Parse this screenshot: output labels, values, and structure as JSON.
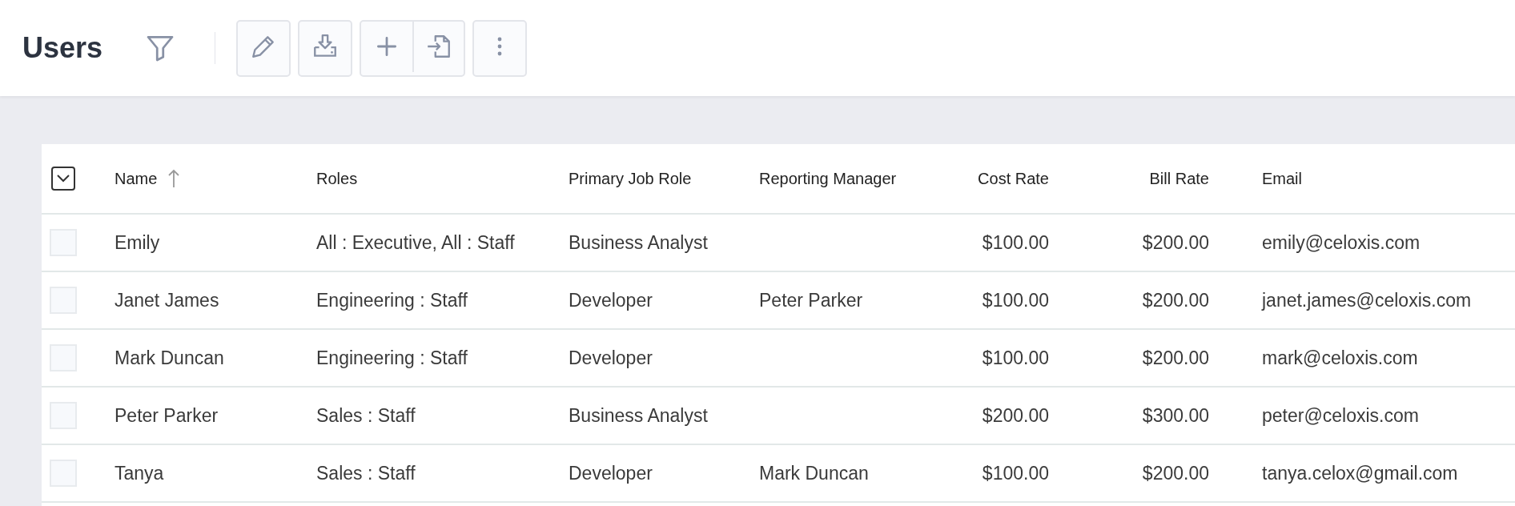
{
  "header": {
    "title": "Users",
    "toolbar": [
      {
        "kind": "filter"
      },
      {
        "kind": "divider"
      },
      {
        "kind": "edit"
      },
      {
        "kind": "download"
      },
      {
        "kind": "add"
      },
      {
        "kind": "import"
      },
      {
        "kind": "more"
      }
    ]
  },
  "table": {
    "columns": [
      {
        "label": "Name",
        "sorted": true
      },
      {
        "label": "Roles",
        "sorted": false
      },
      {
        "label": "Primary Job Role",
        "sorted": false
      },
      {
        "label": "Reporting Manager",
        "sorted": false
      },
      {
        "label": "Cost Rate",
        "sorted": false
      },
      {
        "label": "Bill Rate",
        "sorted": false
      },
      {
        "label": "Email",
        "sorted": false
      }
    ],
    "rows": [
      {
        "selected": false,
        "cells": [
          "Emily",
          "All : Executive, All : Staff",
          "Business Analyst",
          "",
          "$100.00",
          "$200.00",
          "emily@celoxis.com"
        ]
      },
      {
        "selected": false,
        "cells": [
          "Janet James",
          "Engineering : Staff",
          "Developer",
          "Peter Parker",
          "$100.00",
          "$200.00",
          "janet.james@celoxis.com"
        ]
      },
      {
        "selected": false,
        "cells": [
          "Mark Duncan",
          "Engineering : Staff",
          "Developer",
          "",
          "$100.00",
          "$200.00",
          "mark@celoxis.com"
        ]
      },
      {
        "selected": false,
        "cells": [
          "Peter Parker",
          "Sales : Staff",
          "Business Analyst",
          "",
          "$200.00",
          "$300.00",
          "peter@celoxis.com"
        ]
      },
      {
        "selected": false,
        "cells": [
          "Tanya",
          "Sales : Staff",
          "Developer",
          "Mark Duncan",
          "$100.00",
          "$200.00",
          "tanya.celox@gmail.com"
        ]
      }
    ]
  }
}
